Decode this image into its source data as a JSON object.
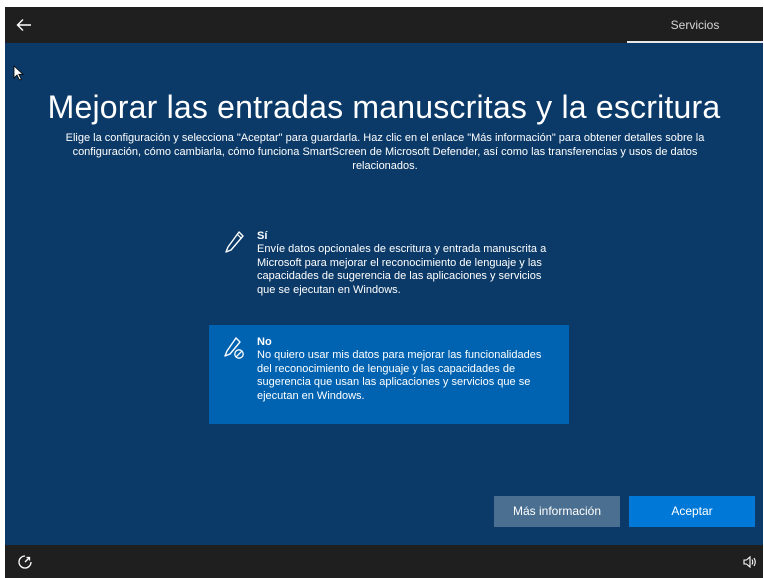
{
  "header": {
    "tab_label": "Servicios"
  },
  "page": {
    "title": "Mejorar las entradas manuscritas y la escritura",
    "subtitle": "Elige la configuración y selecciona \"Aceptar\" para guardarla. Haz clic en el enlace \"Más información\" para obtener detalles sobre la configuración, cómo cambiarla, cómo funciona SmartScreen de Microsoft Defender, así como las transferencias y usos de datos relacionados."
  },
  "options": [
    {
      "title": "Sí",
      "description": "Envíe datos opcionales de escritura y entrada manuscrita a Microsoft para mejorar el reconocimiento de lenguaje y las capacidades de sugerencia de las aplicaciones y servicios que se ejecutan en Windows.",
      "icon": "pen-icon",
      "selected": false
    },
    {
      "title": "No",
      "description": "No quiero usar mis datos para mejorar las funcionalidades del reconocimiento de lenguaje y las capacidades de sugerencia que usan las aplicaciones y servicios que se ejecutan en Windows.",
      "icon": "pen-blocked-icon",
      "selected": true
    }
  ],
  "buttons": {
    "more_info": "Más información",
    "accept": "Aceptar"
  },
  "colors": {
    "background": "#0b3a68",
    "bar": "#1f1f1f",
    "selected_option": "#0063b1",
    "accent": "#0078d7",
    "secondary_button": "#4a6f90"
  }
}
